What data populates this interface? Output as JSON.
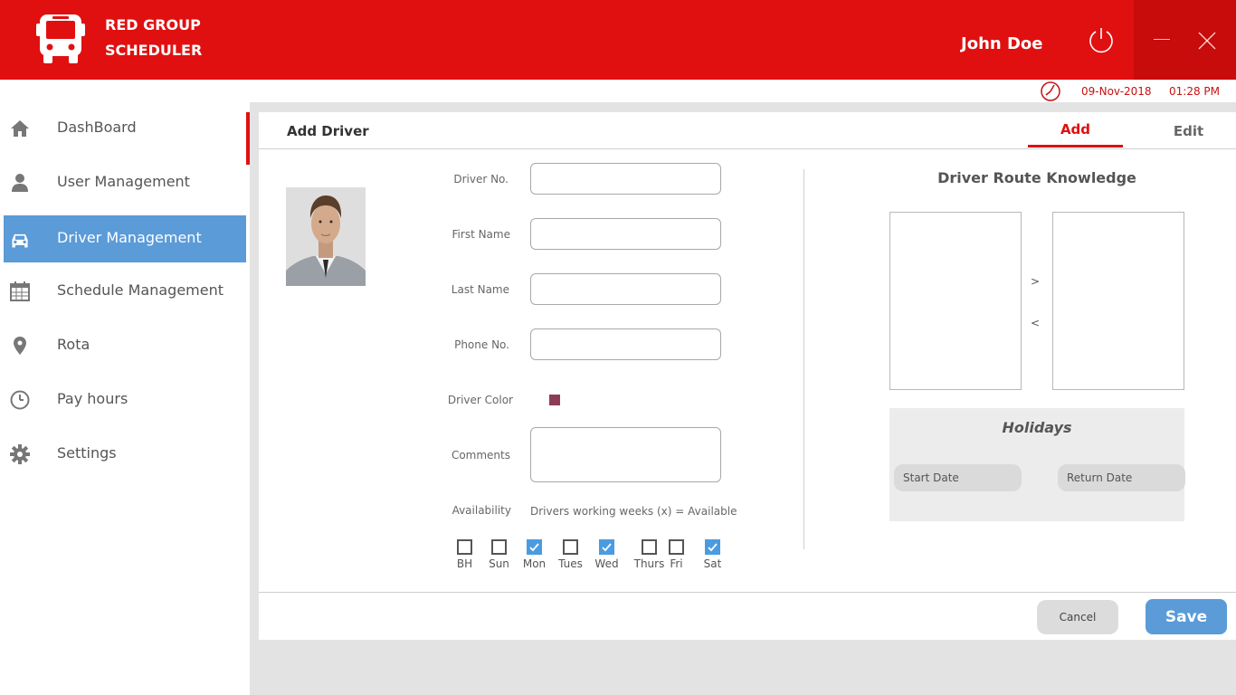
{
  "app": {
    "brand_line1": "RED GROUP",
    "brand_line2": "SCHEDULER",
    "username": "John Doe",
    "logo_icon": "bus-icon",
    "accent_color": "#e01010",
    "active_color": "#5a9bd8"
  },
  "datetime": {
    "date": "09-Nov-2018",
    "time": "01:28 PM"
  },
  "sidebar": {
    "items": [
      {
        "label": "DashBoard",
        "icon": "home-icon"
      },
      {
        "label": "User Management",
        "icon": "user-icon"
      },
      {
        "label": "Driver Management",
        "icon": "car-icon",
        "active": true
      },
      {
        "label": "Schedule Management",
        "icon": "calendar-icon"
      },
      {
        "label": "Rota",
        "icon": "map-pin-icon"
      },
      {
        "label": "Pay hours",
        "icon": "clock-icon"
      },
      {
        "label": "Settings",
        "icon": "gear-icon"
      }
    ]
  },
  "panel": {
    "title": "Add Driver",
    "tab_add": "Add",
    "tab_edit": "Edit"
  },
  "form": {
    "driver_no_label": "Driver No.",
    "first_name_label": "First Name",
    "last_name_label": "Last Name",
    "phone_label": "Phone No.",
    "driver_color_label": "Driver Color",
    "driver_color_value": "#8c3c58",
    "comments_label": "Comments",
    "availability_label": "Availability",
    "availability_note": "Drivers working weeks (x) = Available",
    "days": [
      {
        "label": "BH",
        "checked": false
      },
      {
        "label": "Sun",
        "checked": false
      },
      {
        "label": "Mon",
        "checked": true
      },
      {
        "label": "Tues",
        "checked": false
      },
      {
        "label": "Wed",
        "checked": true
      },
      {
        "label": "Thurs",
        "checked": false
      },
      {
        "label": "Fri",
        "checked": false
      },
      {
        "label": "Sat",
        "checked": true
      }
    ]
  },
  "route": {
    "title": "Driver Route Knowledge",
    "move_right": ">",
    "move_left": "<"
  },
  "holidays": {
    "title": "Holidays",
    "start_date": "Start Date",
    "return_date": "Return Date"
  },
  "buttons": {
    "cancel": "Cancel",
    "save": "Save"
  }
}
